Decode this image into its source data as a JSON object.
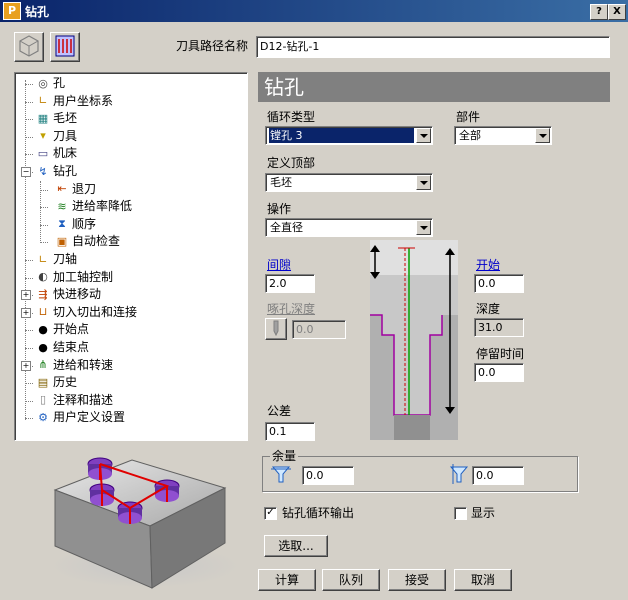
{
  "window": {
    "title": "钻孔",
    "logo": "P",
    "help_btn": "?",
    "close_btn": "X"
  },
  "toolpath_name": {
    "label": "刀具路径名称",
    "value": "D12-钻孔-1"
  },
  "tree": {
    "items": [
      {
        "label": "孔",
        "icon": "hole-icon"
      },
      {
        "label": "用户坐标系",
        "icon": "ucs-icon"
      },
      {
        "label": "毛坯",
        "icon": "block-icon"
      },
      {
        "label": "刀具",
        "icon": "tool-icon"
      },
      {
        "label": "机床",
        "icon": "machine-icon"
      },
      {
        "label": "钻孔",
        "icon": "drill-icon"
      },
      {
        "label": "退刀",
        "icon": "retract-icon"
      },
      {
        "label": "进给率降低",
        "icon": "feed-reduce-icon"
      },
      {
        "label": "顺序",
        "icon": "order-icon"
      },
      {
        "label": "自动检查",
        "icon": "auto-check-icon"
      },
      {
        "label": "刀轴",
        "icon": "tool-axis-icon"
      },
      {
        "label": "加工轴控制",
        "icon": "axis-control-icon"
      },
      {
        "label": "快进移动",
        "icon": "rapid-move-icon"
      },
      {
        "label": "切入切出和连接",
        "icon": "leads-links-icon"
      },
      {
        "label": "开始点",
        "icon": "start-point-icon"
      },
      {
        "label": "结束点",
        "icon": "end-point-icon"
      },
      {
        "label": "进给和转速",
        "icon": "feeds-speeds-icon"
      },
      {
        "label": "历史",
        "icon": "history-icon"
      },
      {
        "label": "注释和描述",
        "icon": "notes-icon"
      },
      {
        "label": "用户定义设置",
        "icon": "user-settings-icon"
      }
    ]
  },
  "page_header": "钻孔",
  "cycle_type": {
    "label": "循环类型",
    "value": "镗孔 3"
  },
  "component": {
    "label": "部件",
    "value": "全部"
  },
  "define_top": {
    "label": "定义顶部",
    "value": "毛坯"
  },
  "operation": {
    "label": "操作",
    "value": "全直径"
  },
  "clearance": {
    "label": "间隙",
    "value": "2.0"
  },
  "start": {
    "label": "开始",
    "value": "0.0"
  },
  "pilot_depth": {
    "label": "啄孔深度",
    "value": "0.0"
  },
  "depth": {
    "label": "深度",
    "value": "31.0"
  },
  "dwell": {
    "label": "停留时间",
    "value": "0.0"
  },
  "tolerance": {
    "label": "公差",
    "value": "0.1"
  },
  "allowance": {
    "label": "余量",
    "radial": "0.0",
    "axial": "0.0"
  },
  "drill_cycle_output": {
    "label": "钻孔循环输出",
    "checked": "✓"
  },
  "display": {
    "label": "显示",
    "checked": ""
  },
  "select_btn": "选取...",
  "buttons": {
    "calculate": "计算",
    "queue": "队列",
    "accept": "接受",
    "cancel": "取消"
  }
}
